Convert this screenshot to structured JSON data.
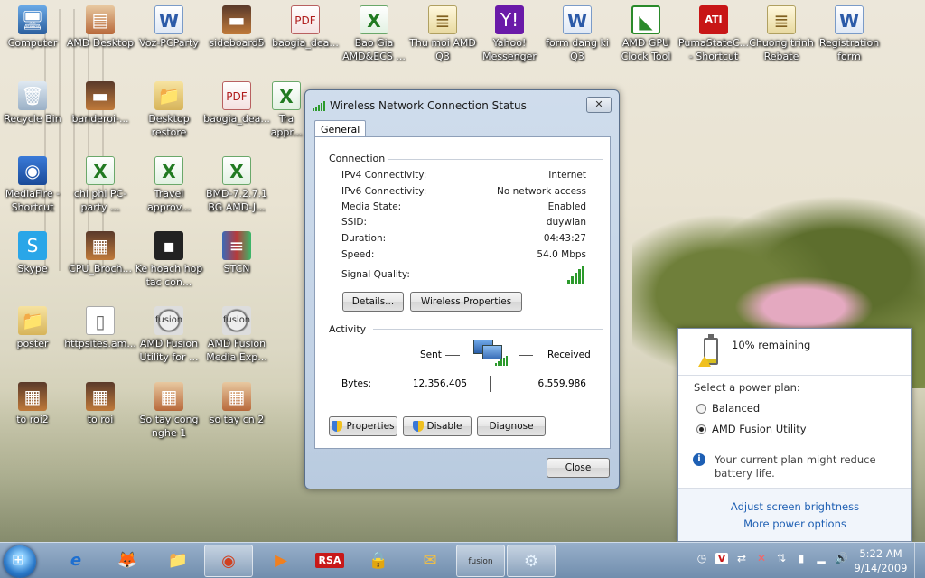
{
  "desktop": {
    "icons": [
      {
        "label": "Computer",
        "glyph": "🖥"
      },
      {
        "label": "AMD Desktop",
        "glyph": "▤"
      },
      {
        "label": "Voz-PCParty",
        "glyph": "W"
      },
      {
        "label": "sideboard5",
        "glyph": "▬"
      },
      {
        "label": "baogia_dea...",
        "glyph": "PDF"
      },
      {
        "label": "Bao Gia AMD&ECS ...",
        "glyph": "X"
      },
      {
        "label": "Thu moi AMD Q3",
        "glyph": "≣"
      },
      {
        "label": "Yahoo! Messenger",
        "glyph": "Y!"
      },
      {
        "label": "form dang ki Q3",
        "glyph": "W"
      },
      {
        "label": "AMD GPU Clock Tool",
        "glyph": "◣"
      },
      {
        "label": "PumaStateC... - Shortcut",
        "glyph": "ATI"
      },
      {
        "label": "Chuong trinh Rebate",
        "glyph": "≣"
      },
      {
        "label": "Registration form",
        "glyph": "W"
      },
      {
        "label": "Recycle Bin",
        "glyph": "🗑"
      },
      {
        "label": "banderoi-...",
        "glyph": "▬"
      },
      {
        "label": "Desktop restore",
        "glyph": "📁"
      },
      {
        "label": "baogia_dea...",
        "glyph": "PDF"
      },
      {
        "label": "Tra appr...",
        "glyph": "X"
      },
      {
        "label": "MediaFire - Shortcut",
        "glyph": "◉"
      },
      {
        "label": "chi phi PC-party ...",
        "glyph": "X"
      },
      {
        "label": "Travel approv...",
        "glyph": "X"
      },
      {
        "label": "BMD-7.2.7.1 BG AMD-J...",
        "glyph": "X"
      },
      {
        "label": "Skype",
        "glyph": "S"
      },
      {
        "label": "CPU_Broch...",
        "glyph": "▦"
      },
      {
        "label": "Ke hoach hop tac con...",
        "glyph": "▪"
      },
      {
        "label": "STCN",
        "glyph": "≡"
      },
      {
        "label": "poster",
        "glyph": "📁"
      },
      {
        "label": "httpsites.am...",
        "glyph": "▯"
      },
      {
        "label": "AMD Fusion Utility for ...",
        "glyph": "fusion"
      },
      {
        "label": "AMD Fusion Media Exp...",
        "glyph": "fusion"
      },
      {
        "label": "to roi2",
        "glyph": "▦"
      },
      {
        "label": "to roi",
        "glyph": "▦"
      },
      {
        "label": "So tay cong nghe 1",
        "glyph": "▦"
      },
      {
        "label": "so tay cn 2",
        "glyph": "▦"
      }
    ]
  },
  "dialog": {
    "title": "Wireless Network Connection Status",
    "close_glyph": "✕",
    "tab_general": "General",
    "connection_heading": "Connection",
    "rows": [
      {
        "label": "IPv4 Connectivity:",
        "value": "Internet"
      },
      {
        "label": "IPv6 Connectivity:",
        "value": "No network access"
      },
      {
        "label": "Media State:",
        "value": "Enabled"
      },
      {
        "label": "SSID:",
        "value": "duywlan"
      },
      {
        "label": "Duration:",
        "value": "04:43:27"
      },
      {
        "label": "Speed:",
        "value": "54.0 Mbps"
      }
    ],
    "signal_label": "Signal Quality:",
    "signal_bars": 5,
    "details_button": "Details...",
    "wireless_props_button": "Wireless Properties",
    "activity_heading": "Activity",
    "sent_label": "Sent",
    "received_label": "Received",
    "bytes_label": "Bytes:",
    "bytes_sent": "12,356,405",
    "bytes_received": "6,559,986",
    "properties_button": "Properties",
    "disable_button": "Disable",
    "diagnose_button": "Diagnose",
    "close_button": "Close"
  },
  "power": {
    "remaining": "10% remaining",
    "select_plan": "Select a power plan:",
    "plans": [
      {
        "label": "Balanced",
        "selected": false
      },
      {
        "label": "AMD Fusion Utility",
        "selected": true
      }
    ],
    "warning": "Your current plan might reduce battery life.",
    "brightness_link": "Adjust screen brightness",
    "more_options_link": "More power options"
  },
  "taskbar": {
    "apps": [
      "e",
      "🦊",
      "📁",
      "◉",
      "▶",
      "RSA",
      "🔒",
      "✉",
      "fusion",
      "⚙"
    ],
    "tray_icons": [
      "◷",
      "V",
      "⇄",
      "✕",
      "⇅",
      "▮",
      "▂",
      "🔊"
    ],
    "time": "5:22 AM",
    "date": "9/14/2009"
  },
  "colors": {
    "accent": "#1e5fb3",
    "signal": "#2c9a2c"
  }
}
